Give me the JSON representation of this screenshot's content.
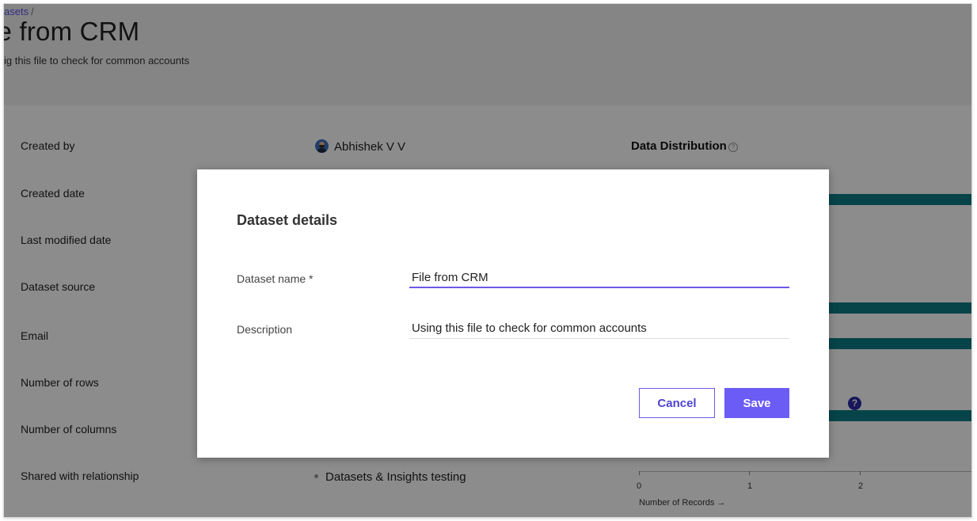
{
  "header": {
    "breadcrumb_link": "asets",
    "breadcrumb_separator": "/",
    "title": "le from CRM",
    "subtitle": "ig this file to check for common accounts"
  },
  "details": {
    "labels": {
      "created_by": "Created by",
      "created_date": "Created date",
      "last_modified_date": "Last modified date",
      "dataset_source": "Dataset source",
      "email": "Email",
      "number_of_rows": "Number of rows",
      "number_of_columns": "Number of columns",
      "shared_with_relationship": "Shared with relationship"
    },
    "created_by_value": "Abhishek V V",
    "shared_with_value": "Datasets & Insights testing"
  },
  "distribution": {
    "title": "Data Distribution",
    "help_symbol": "?",
    "axis_title": "Number of Records →",
    "tick_labels": [
      "0",
      "1",
      "2"
    ]
  },
  "modal": {
    "title": "Dataset details",
    "name_label": "Dataset name *",
    "name_value": "File from CRM",
    "description_label": "Description",
    "description_value": "Using this file to check for common accounts",
    "cancel_label": "Cancel",
    "save_label": "Save"
  },
  "colors": {
    "accent": "#6b5cf6",
    "bar": "#0e7c86",
    "overlay": "rgba(0,0,0,0.45)"
  }
}
